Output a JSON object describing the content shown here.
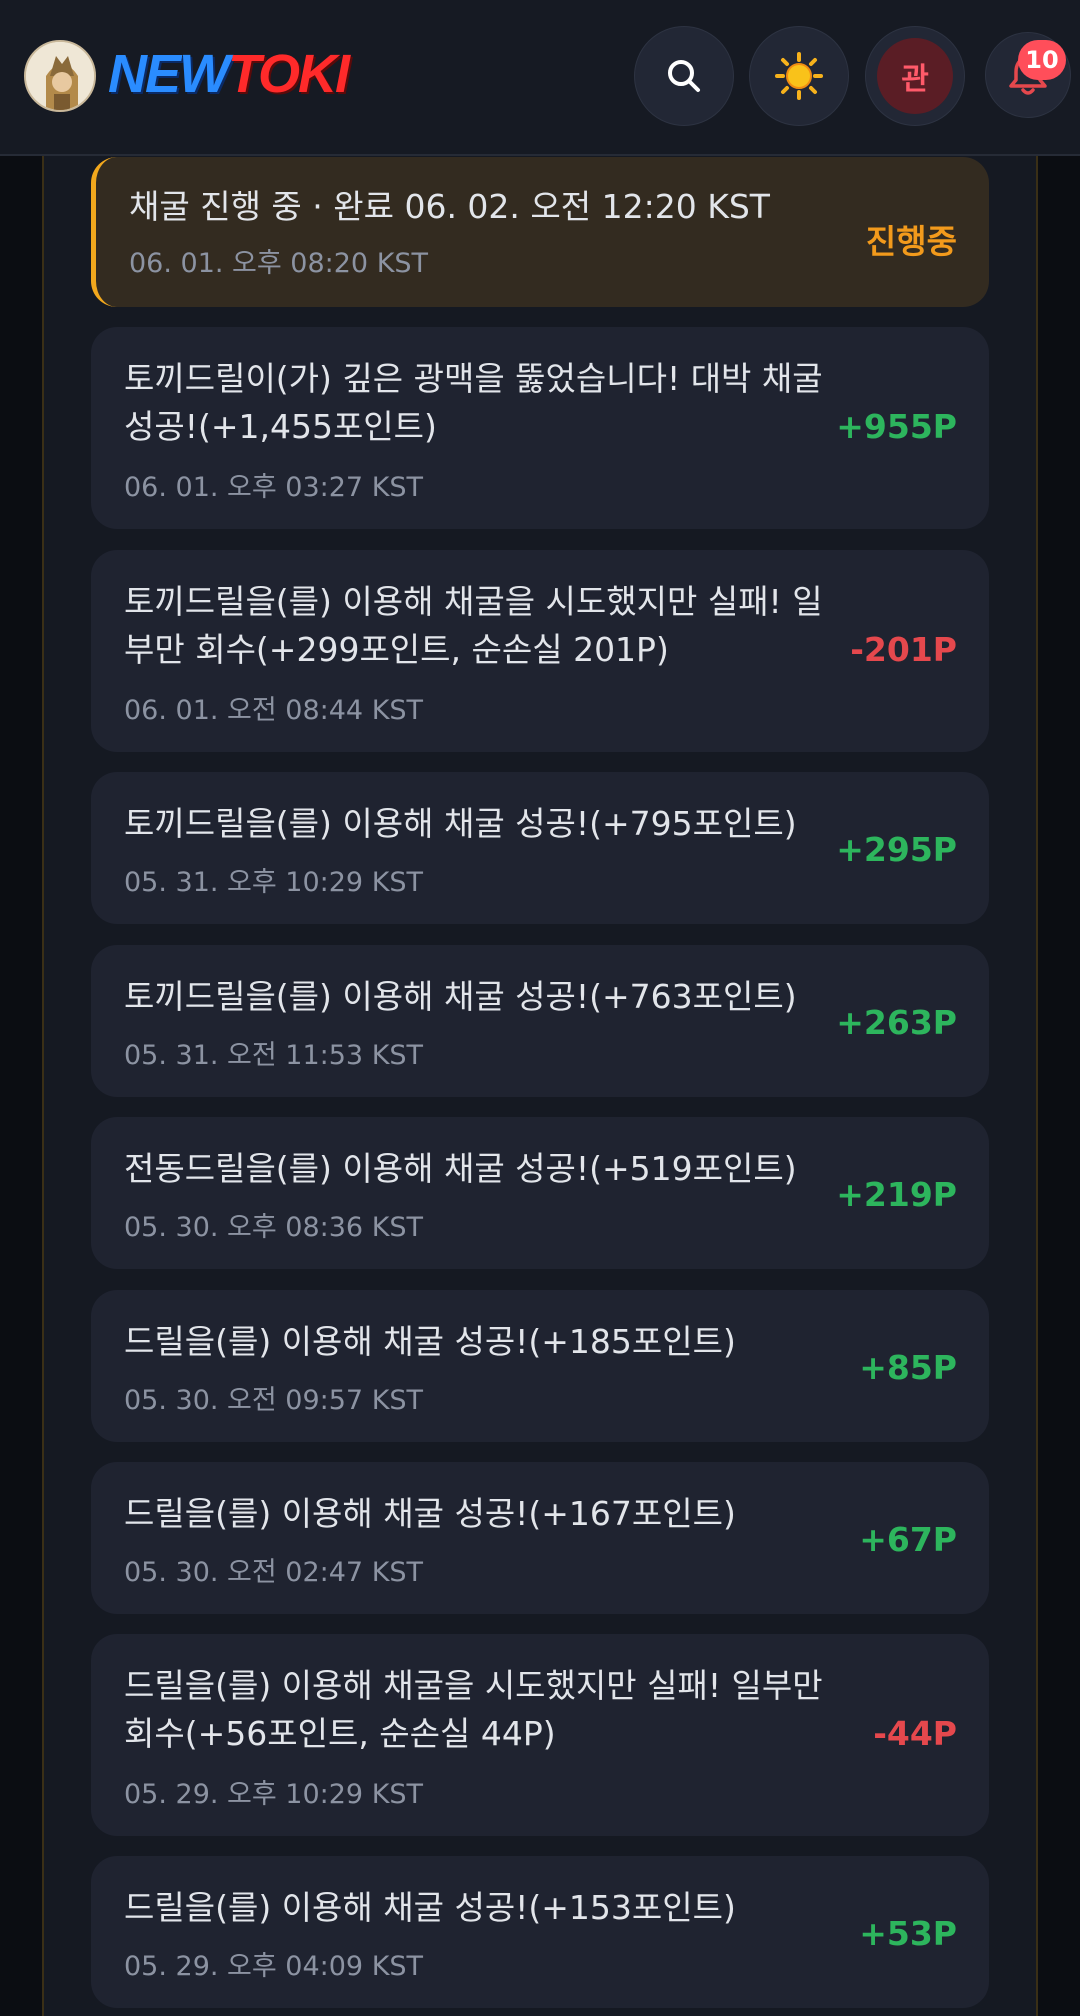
{
  "header": {
    "logo_new": "NEW",
    "logo_toki": "TOKI",
    "user_label": "관",
    "notification_count": "10",
    "icons": [
      "search-icon",
      "sun-icon",
      "bell-icon"
    ]
  },
  "colors": {
    "positive": "#2db55d",
    "negative": "#e5484d",
    "in_progress": "#f29a1c"
  },
  "history": [
    {
      "text": "채굴 진행 중 · 완료 06. 02. 오전 12:20 KST",
      "time": "06. 01. 오후 08:20 KST",
      "amount": "진행중",
      "status": "in_progress"
    },
    {
      "text": "토끼드릴이(가) 깊은 광맥을 뚫었습니다! 대박 채굴 성공!(+1,455포인트)",
      "time": "06. 01. 오후 03:27 KST",
      "amount": "+955P",
      "status": "positive"
    },
    {
      "text": "토끼드릴을(를) 이용해 채굴을 시도했지만 실패! 일부만 회수(+299포인트, 순손실 201P)",
      "time": "06. 01. 오전 08:44 KST",
      "amount": "-201P",
      "status": "negative"
    },
    {
      "text": "토끼드릴을(를) 이용해 채굴 성공!(+795포인트)",
      "time": "05. 31. 오후 10:29 KST",
      "amount": "+295P",
      "status": "positive"
    },
    {
      "text": "토끼드릴을(를) 이용해 채굴 성공!(+763포인트)",
      "time": "05. 31. 오전 11:53 KST",
      "amount": "+263P",
      "status": "positive"
    },
    {
      "text": "전동드릴을(를) 이용해 채굴 성공!(+519포인트)",
      "time": "05. 30. 오후 08:36 KST",
      "amount": "+219P",
      "status": "positive"
    },
    {
      "text": "드릴을(를) 이용해 채굴 성공!(+185포인트)",
      "time": "05. 30. 오전 09:57 KST",
      "amount": "+85P",
      "status": "positive"
    },
    {
      "text": "드릴을(를) 이용해 채굴 성공!(+167포인트)",
      "time": "05. 30. 오전 02:47 KST",
      "amount": "+67P",
      "status": "positive"
    },
    {
      "text": "드릴을(를) 이용해 채굴을 시도했지만 실패! 일부만 회수(+56포인트, 순손실 44P)",
      "time": "05. 29. 오후 10:29 KST",
      "amount": "-44P",
      "status": "negative"
    },
    {
      "text": "드릴을(를) 이용해 채굴 성공!(+153포인트)",
      "time": "05. 29. 오후 04:09 KST",
      "amount": "+53P",
      "status": "positive"
    }
  ]
}
